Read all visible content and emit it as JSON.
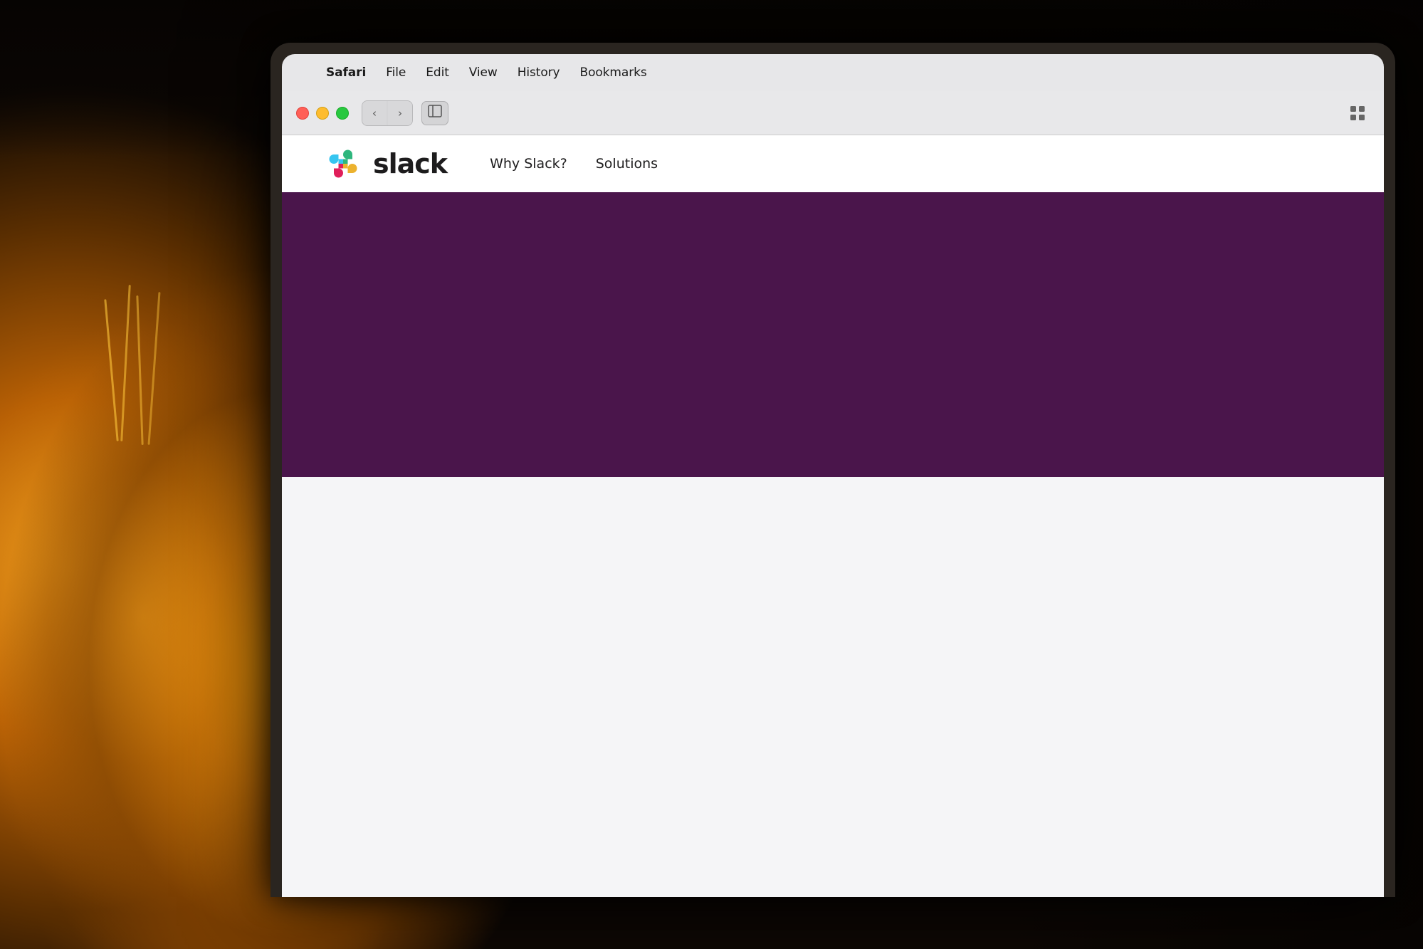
{
  "background": {
    "color": "#0e0804"
  },
  "macos_menubar": {
    "apple_symbol": "",
    "items": [
      {
        "label": "Safari",
        "bold": true
      },
      {
        "label": "File"
      },
      {
        "label": "Edit"
      },
      {
        "label": "View"
      },
      {
        "label": "History"
      },
      {
        "label": "Bookmarks"
      }
    ]
  },
  "safari_toolbar": {
    "back_button_label": "‹",
    "forward_button_label": "›",
    "sidebar_icon": "⊡",
    "grid_icon": "⠿"
  },
  "traffic_lights": {
    "red_label": "close",
    "yellow_label": "minimize",
    "green_label": "maximize"
  },
  "slack_page": {
    "logo_text": "slack",
    "nav_items": [
      {
        "label": "Why Slack?"
      },
      {
        "label": "Solutions"
      }
    ],
    "hero_color": "#4a154b"
  }
}
